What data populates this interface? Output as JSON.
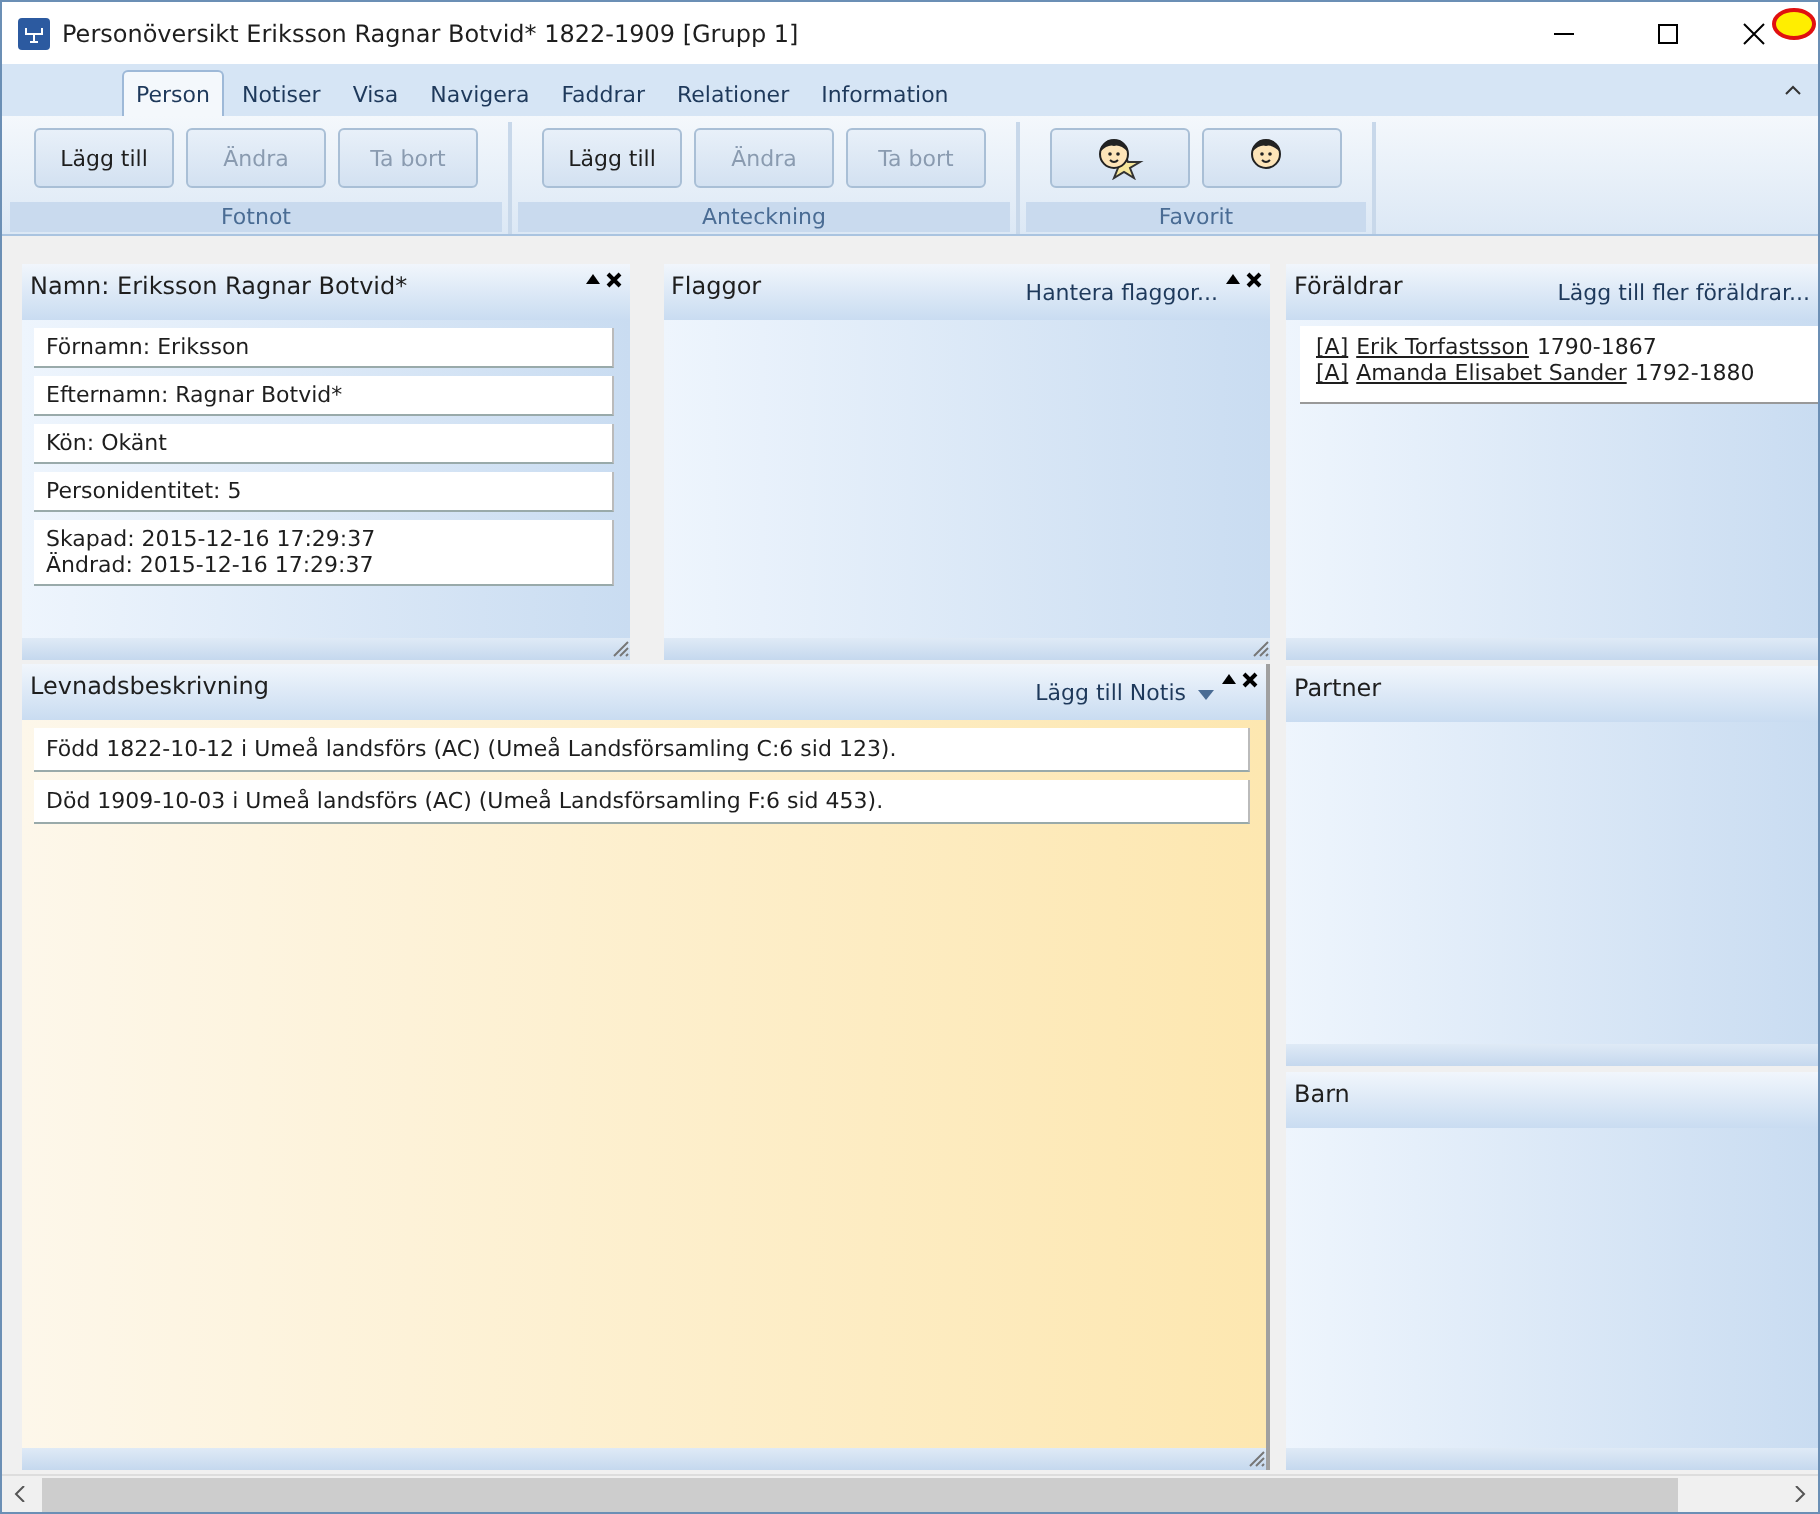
{
  "window": {
    "title": "Personöversikt Eriksson Ragnar Botvid* 1822-1909 [Grupp 1]"
  },
  "ribbon_tabs": [
    {
      "label": "Person",
      "selected": true
    },
    {
      "label": "Notiser",
      "selected": false
    },
    {
      "label": "Visa",
      "selected": false
    },
    {
      "label": "Navigera",
      "selected": false
    },
    {
      "label": "Faddrar",
      "selected": false
    },
    {
      "label": "Relationer",
      "selected": false
    },
    {
      "label": "Information",
      "selected": false
    }
  ],
  "ribbon_groups": [
    {
      "label": "Fotnot",
      "buttons": [
        {
          "kind": "text",
          "label": "Lägg till",
          "disabled": false
        },
        {
          "kind": "text",
          "label": "Ändra",
          "disabled": true
        },
        {
          "kind": "text",
          "label": "Ta bort",
          "disabled": true
        }
      ]
    },
    {
      "label": "Anteckning",
      "buttons": [
        {
          "kind": "text",
          "label": "Lägg till",
          "disabled": false
        },
        {
          "kind": "text",
          "label": "Ändra",
          "disabled": true
        },
        {
          "kind": "text",
          "label": "Ta bort",
          "disabled": true
        }
      ]
    },
    {
      "label": "Favorit",
      "buttons": [
        {
          "kind": "starface"
        },
        {
          "kind": "face"
        }
      ]
    }
  ],
  "name_panel": {
    "title": "Namn: Eriksson Ragnar Botvid*",
    "controls": true,
    "fields": [
      [
        "Förnamn: Eriksson"
      ],
      [
        "Efternamn: Ragnar Botvid*"
      ],
      [
        "Kön: Okänt"
      ],
      [
        "Personidentitet: 5"
      ],
      [
        "Skapad: 2015-12-16 17:29:37",
        "Ändrad: 2015-12-16 17:29:37"
      ]
    ]
  },
  "flags_panel": {
    "title": "Flaggor",
    "action": "Hantera flaggor...",
    "controls": true
  },
  "parents_panel": {
    "title": "Föräldrar",
    "action": "Lägg till fler föräldrar...",
    "parents": [
      {
        "tag": "[A]",
        "name": "Erik Torfastsson",
        "years": "1790-1867"
      },
      {
        "tag": "[A]",
        "name": "Amanda Elisabet Sander",
        "years": "1792-1880"
      }
    ]
  },
  "life_panel": {
    "title": "Levnadsbeskrivning",
    "action": "Lägg till Notis",
    "controls": true,
    "events": [
      "Född 1822-10-12 i Umeå landsförs (AC) (Umeå Landsförsamling C:6 sid  123).",
      "Död 1909-10-03 i Umeå landsförs (AC) (Umeå Landsförsamling F:6 sid  453)."
    ]
  },
  "partner_panel": {
    "title": "Partner"
  },
  "children_panel": {
    "title": "Barn"
  }
}
